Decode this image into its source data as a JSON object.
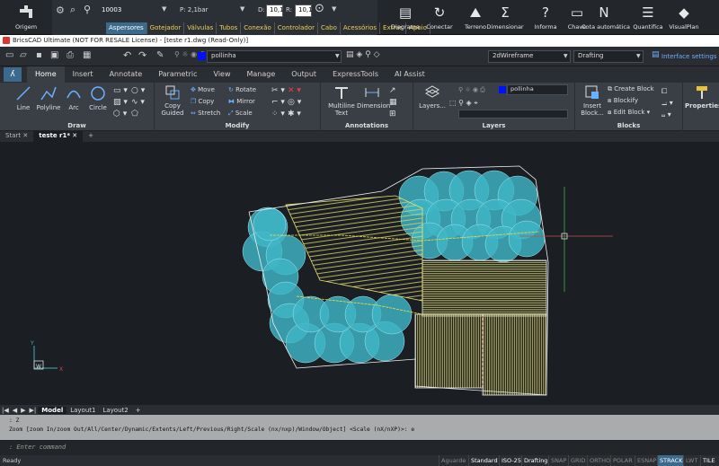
{
  "plugin": {
    "origem": "Origem",
    "tabs": [
      "Aspersores",
      "Gotejador",
      "Válvulas",
      "Tubos",
      "Conexão",
      "Controlador",
      "Cabo",
      "Acessórios",
      "Extras",
      "Apoio"
    ],
    "code": "10003",
    "pressure": "P: 2,1bar",
    "d_label": "D:",
    "d_value": "10,1",
    "r_label": "R:",
    "r_value": "10,1",
    "buttons": [
      "Diagrama",
      "Conectar",
      "Terreno",
      "Dimensionar",
      "Informa",
      "Chave",
      "Cota automática",
      "Quantifica",
      "VisualPlan"
    ]
  },
  "titlebar": "BricsCAD Ultimate (NOT FOR RESALE License) - [teste r1.dwg (Read-Only)]",
  "quickbar": {
    "layer": "pollinha",
    "visual_style": "2dWireframe",
    "workspace": "Drafting",
    "interface_settings": "Interface settings"
  },
  "ribbon_tabs": [
    "Home",
    "Insert",
    "Annotate",
    "Parametric",
    "View",
    "Manage",
    "Output",
    "ExpressTools",
    "AI Assist"
  ],
  "ribbon": {
    "draw": {
      "title": "Draw",
      "line": "Line",
      "polyline": "Polyline",
      "arc": "Arc",
      "circle": "Circle"
    },
    "modify": {
      "title": "Modify",
      "copy_guided": "Copy Guided",
      "move": "Move",
      "copy": "Copy",
      "stretch": "Stretch",
      "rotate": "Rotate",
      "mirror": "Mirror",
      "scale": "Scale"
    },
    "annotations": {
      "title": "Annotations",
      "mtext": "Multiline Text",
      "dimension": "Dimension"
    },
    "layers": {
      "title": "Layers",
      "layers": "Layers...",
      "current": "pollinha"
    },
    "blocks": {
      "title": "Blocks",
      "insert": "Insert Block...",
      "create": "Create Block",
      "blockify": "Blockify",
      "edit": "Edit Block"
    },
    "properties": "Properties"
  },
  "doc_tabs": [
    "Start",
    "teste r1*"
  ],
  "layout_tabs": [
    "Model",
    "Layout1",
    "Layout2"
  ],
  "command": {
    "line1": ": Z",
    "line2": "Zoom [zoom In/zoom Out/All/Center/Dynamic/Extents/Left/Previous/Right/Scale (nx/nxp)/Window/Object] <Scale (nX/nXP)>: e",
    "prompt": ": Enter command"
  },
  "status": {
    "ready": "Ready",
    "items": [
      "Aguarde",
      "Standard",
      "ISO-25",
      "Drafting",
      "SNAP",
      "GRID",
      "ORTHO",
      "POLAR",
      "ESNAP",
      "STRACK",
      "LWT",
      "TILE"
    ]
  },
  "colors": {
    "accent": "#3c6a8c",
    "circle": "#3fb6c6",
    "hatch": "#d9d36a"
  }
}
